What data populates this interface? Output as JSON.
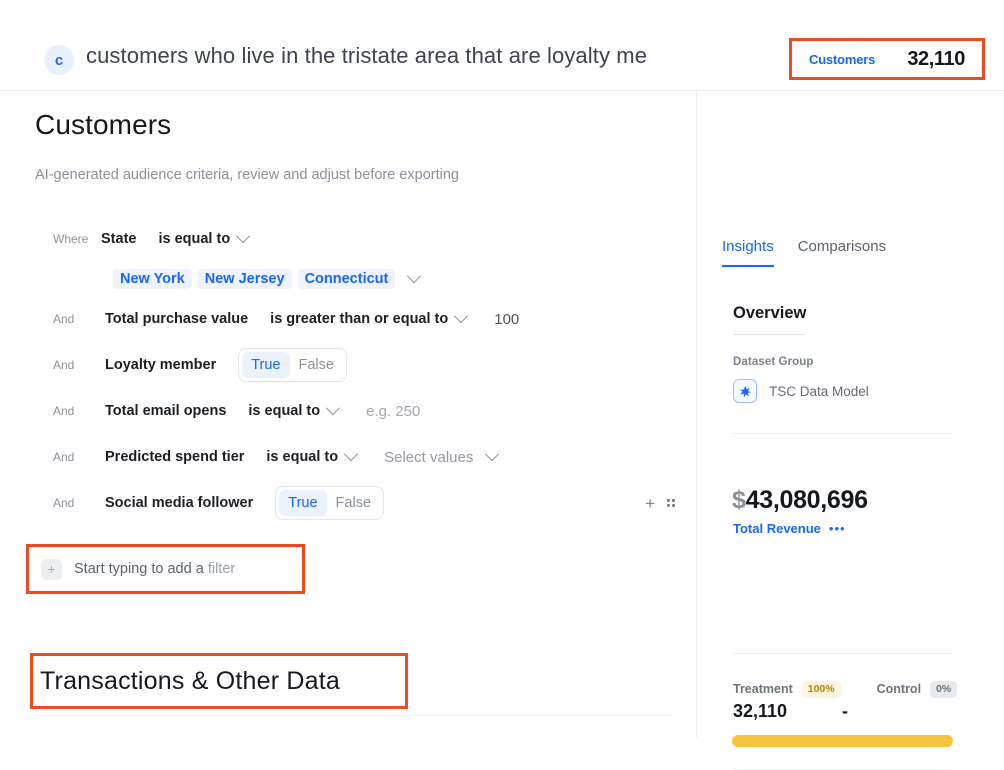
{
  "header": {
    "avatar_initial": "c",
    "prompt": "customers who live in the tristate area that are loyalty me",
    "counter": {
      "label": "Customers",
      "value": "32,110"
    }
  },
  "main": {
    "title": "Customers",
    "subtitle": "AI-generated audience criteria, review and adjust before exporting",
    "filters": [
      {
        "conjunction": "Where",
        "field": "State",
        "operator": "is equal to",
        "value_type": "chips",
        "chips": [
          "New York",
          "New Jersey",
          "Connecticut"
        ]
      },
      {
        "conjunction": "And",
        "field": "Total purchase value",
        "operator": "is greater than or equal to",
        "value_type": "number",
        "value": "100"
      },
      {
        "conjunction": "And",
        "field": "Loyalty member",
        "value_type": "boolean",
        "options": [
          "True",
          "False"
        ],
        "selected": "True"
      },
      {
        "conjunction": "And",
        "field": "Total email opens",
        "operator": "is equal to",
        "value_type": "placeholder",
        "placeholder": "e.g. 250"
      },
      {
        "conjunction": "And",
        "field": "Predicted spend tier",
        "operator": "is equal to",
        "value_type": "select",
        "placeholder": "Select values"
      },
      {
        "conjunction": "And",
        "field": "Social media follower",
        "value_type": "boolean",
        "options": [
          "True",
          "False"
        ],
        "selected": "True"
      }
    ],
    "add_filter": {
      "prefix": "Start typing to add a",
      "muted_word": "filter"
    },
    "bottom_section_title": "Transactions & Other Data"
  },
  "insights": {
    "tabs": [
      "Insights",
      "Comparisons"
    ],
    "active_tab": "Insights",
    "overview_title": "Overview",
    "dataset_group": {
      "label": "Dataset Group",
      "icon": "sparkle-icon",
      "name": "TSC Data Model"
    },
    "metric": {
      "currency": "$",
      "value": "43,080,696",
      "label": "Total Revenue",
      "menu": "•••"
    },
    "split": {
      "treatment": {
        "name": "Treatment",
        "percent": "100%",
        "value": "32,110"
      },
      "control": {
        "name": "Control",
        "percent": "0%",
        "value": "-"
      }
    }
  },
  "colors": {
    "accent_blue": "#1766ff",
    "annotation_red": "#f04a25",
    "treatment_amber": "#f6c33f"
  }
}
